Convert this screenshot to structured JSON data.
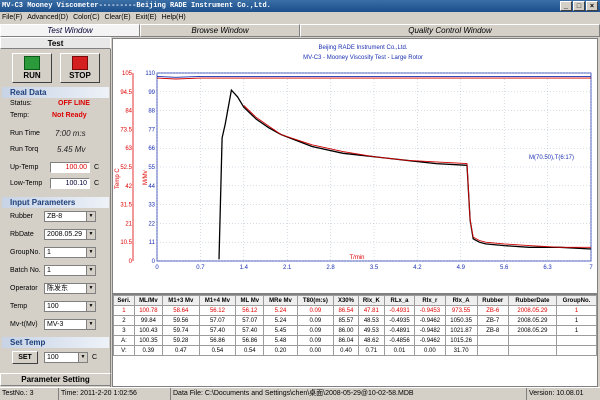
{
  "window": {
    "title": "MV-C3 Mooney Viscometer---------Beijing RADE Instrument Co.,Ltd."
  },
  "menu": [
    "File(F)",
    "Advanced(D)",
    "Color(C)",
    "Clear(E)",
    "Exit(E)",
    "Help(H)"
  ],
  "tabs": [
    "Test Window",
    "Browse Window",
    "Quality Control Window"
  ],
  "left": {
    "panel_title": "Test",
    "run_label": "RUN",
    "stop_label": "STOP",
    "real_data_title": "Real Data",
    "status_label": "Status:",
    "status_value": "OFF LINE",
    "temp_label": "Temp:",
    "temp_value": "Not Ready",
    "run_time_label": "Run Time",
    "run_time_value": "7:00 m:s",
    "run_torq_label": "Run Torq",
    "run_torq_value": "5.45 Mv",
    "up_temp_label": "Up-Temp",
    "up_temp_value": "100.00",
    "low_temp_label": "Low-Temp",
    "low_temp_value": "100.10",
    "temp_unit": "C",
    "input_params_title": "Input Parameters",
    "rubber_label": "Rubber",
    "rubber_value": "ZB-8",
    "rbdate_label": "RbDate",
    "rbdate_value": "2008.05.29",
    "groupno_label": "GroupNo.",
    "groupno_value": "1",
    "batchno_label": "Batch No.",
    "batchno_value": "1",
    "operator_label": "Operator",
    "operator_value": "陈发东",
    "temp2_label": "Temp",
    "temp2_value": "100",
    "mvt_label": "Mv-t(Mv)",
    "mvt_value": "MV-3",
    "set_temp_title": "Set Temp",
    "set_label": "SET",
    "set_value": "100",
    "param_setting": "Parameter Setting"
  },
  "chart_data": {
    "type": "line",
    "title": "Beijing RADE Instrument Co.,Ltd.",
    "subtitle": "MV-C3 - Mooney Viscosity Test - Large Rotor",
    "xlabel": "T/min",
    "ylabel_left": "Temp C",
    "ylabel_right": "M/Mv",
    "xlim": [
      0,
      7.0
    ],
    "ylim_temp": [
      0,
      105
    ],
    "ylim_mv": [
      0,
      110
    ],
    "x_ticks": [
      "0",
      "0.7",
      "1.4",
      "2.1",
      "2.8",
      "3.5",
      "4.2",
      "4.9",
      "5.6",
      "6.3",
      "7"
    ],
    "y_temp_ticks": [
      "0",
      "10.5",
      "21",
      "31.5",
      "42",
      "52.5",
      "63",
      "73.5",
      "84",
      "94.5",
      "105"
    ],
    "y_mv_ticks": [
      "0",
      "11",
      "22",
      "33",
      "44",
      "55",
      "66",
      "77",
      "88",
      "99",
      "110"
    ],
    "annotation": "M(70.50),T(6:17)",
    "series": [
      {
        "color": "#000000",
        "x": [
          1.0,
          1.05,
          1.1,
          1.2,
          1.3,
          1.4,
          1.6,
          1.8,
          2.0,
          2.5,
          3.0,
          3.5,
          4.0,
          4.5,
          5.0,
          5.05,
          5.1,
          5.2,
          5.3,
          5.6,
          6.0,
          6.5,
          7.0
        ],
        "y": [
          1,
          72,
          80,
          100,
          96,
          90,
          83,
          78,
          74,
          67,
          63,
          61,
          59,
          57,
          56,
          24,
          13,
          11,
          10,
          9,
          8,
          8,
          7
        ]
      },
      {
        "color": "#d00000",
        "x": [
          1.4,
          1.6,
          1.8,
          2.0,
          2.5,
          3.0,
          3.5,
          4.0,
          4.5,
          5.0,
          5.05,
          5.1,
          5.2,
          5.3,
          5.6,
          6.0,
          6.5,
          7.0
        ],
        "y": [
          91,
          84,
          79,
          74,
          68,
          64,
          61,
          59,
          58,
          57,
          24,
          14,
          12,
          11,
          10,
          9,
          8,
          8
        ]
      },
      {
        "color": "#1a2fb0",
        "x": [
          0,
          0.3,
          0.7,
          1.0,
          1.4,
          2.0,
          3.0,
          4.0,
          5.0,
          6.0,
          7.0
        ],
        "y": [
          108,
          107.5,
          108,
          108,
          108,
          108,
          108,
          108,
          108,
          108,
          108
        ]
      },
      {
        "color": "#d00000",
        "x": [
          0,
          0.3,
          0.7,
          1.0,
          1.4,
          2.0,
          3.0,
          4.0,
          5.0,
          6.0,
          7.0
        ],
        "y": [
          107,
          106.5,
          107,
          107,
          107,
          107,
          107,
          107,
          107,
          107,
          107
        ]
      }
    ]
  },
  "table": {
    "headers": [
      "Seri.",
      "ML/Mv",
      "M1+3 Mv",
      "M1+4 Mv",
      "ML Mv",
      "MRe Mv",
      "T80(m:s)",
      "X30%",
      "Rlx_K",
      "RLx_a",
      "Rlx_r",
      "Rlx_A",
      "Rubber",
      "RubberDate",
      "GroupNo."
    ],
    "rows": [
      [
        "1",
        "100.78",
        "58.64",
        "56.12",
        "56.12",
        "5.24",
        "0.09",
        "86.54",
        "47.81",
        "-0.4931",
        "-0.9453",
        "973.55",
        "ZB-6",
        "2008.05.29",
        "1"
      ],
      [
        "2",
        "99.84",
        "59.56",
        "57.07",
        "57.07",
        "5.24",
        "0.09",
        "85.57",
        "48.53",
        "-0.4935",
        "-0.9462",
        "1050.35",
        "ZB-7",
        "2008.05.29",
        "1"
      ],
      [
        "3",
        "100.43",
        "59.74",
        "57.40",
        "57.40",
        "5.45",
        "0.09",
        "86.00",
        "49.53",
        "-0.4891",
        "-0.9482",
        "1021.87",
        "ZB-8",
        "2008.05.29",
        "1"
      ],
      [
        "A:",
        "100.35",
        "59.28",
        "56.86",
        "56.86",
        "5.48",
        "0.09",
        "86.04",
        "48.62",
        "-0.4856",
        "-0.9462",
        "1015.26",
        "",
        "",
        ""
      ],
      [
        "V:",
        "0.39",
        "0.47",
        "0.54",
        "0.54",
        "0.20",
        "0.00",
        "0.40",
        "0.71",
        "0.01",
        "0.00",
        "31.70",
        "",
        "",
        ""
      ]
    ]
  },
  "status": {
    "testno": "TestNo.: 3",
    "time": "Time: 2011-2-20 1:02:56",
    "datafile": "Data File: C:\\Documents and Settings\\chen\\桌面\\2008-05-29@10-02-58.MDB",
    "version": "Version: 10.08.01"
  }
}
